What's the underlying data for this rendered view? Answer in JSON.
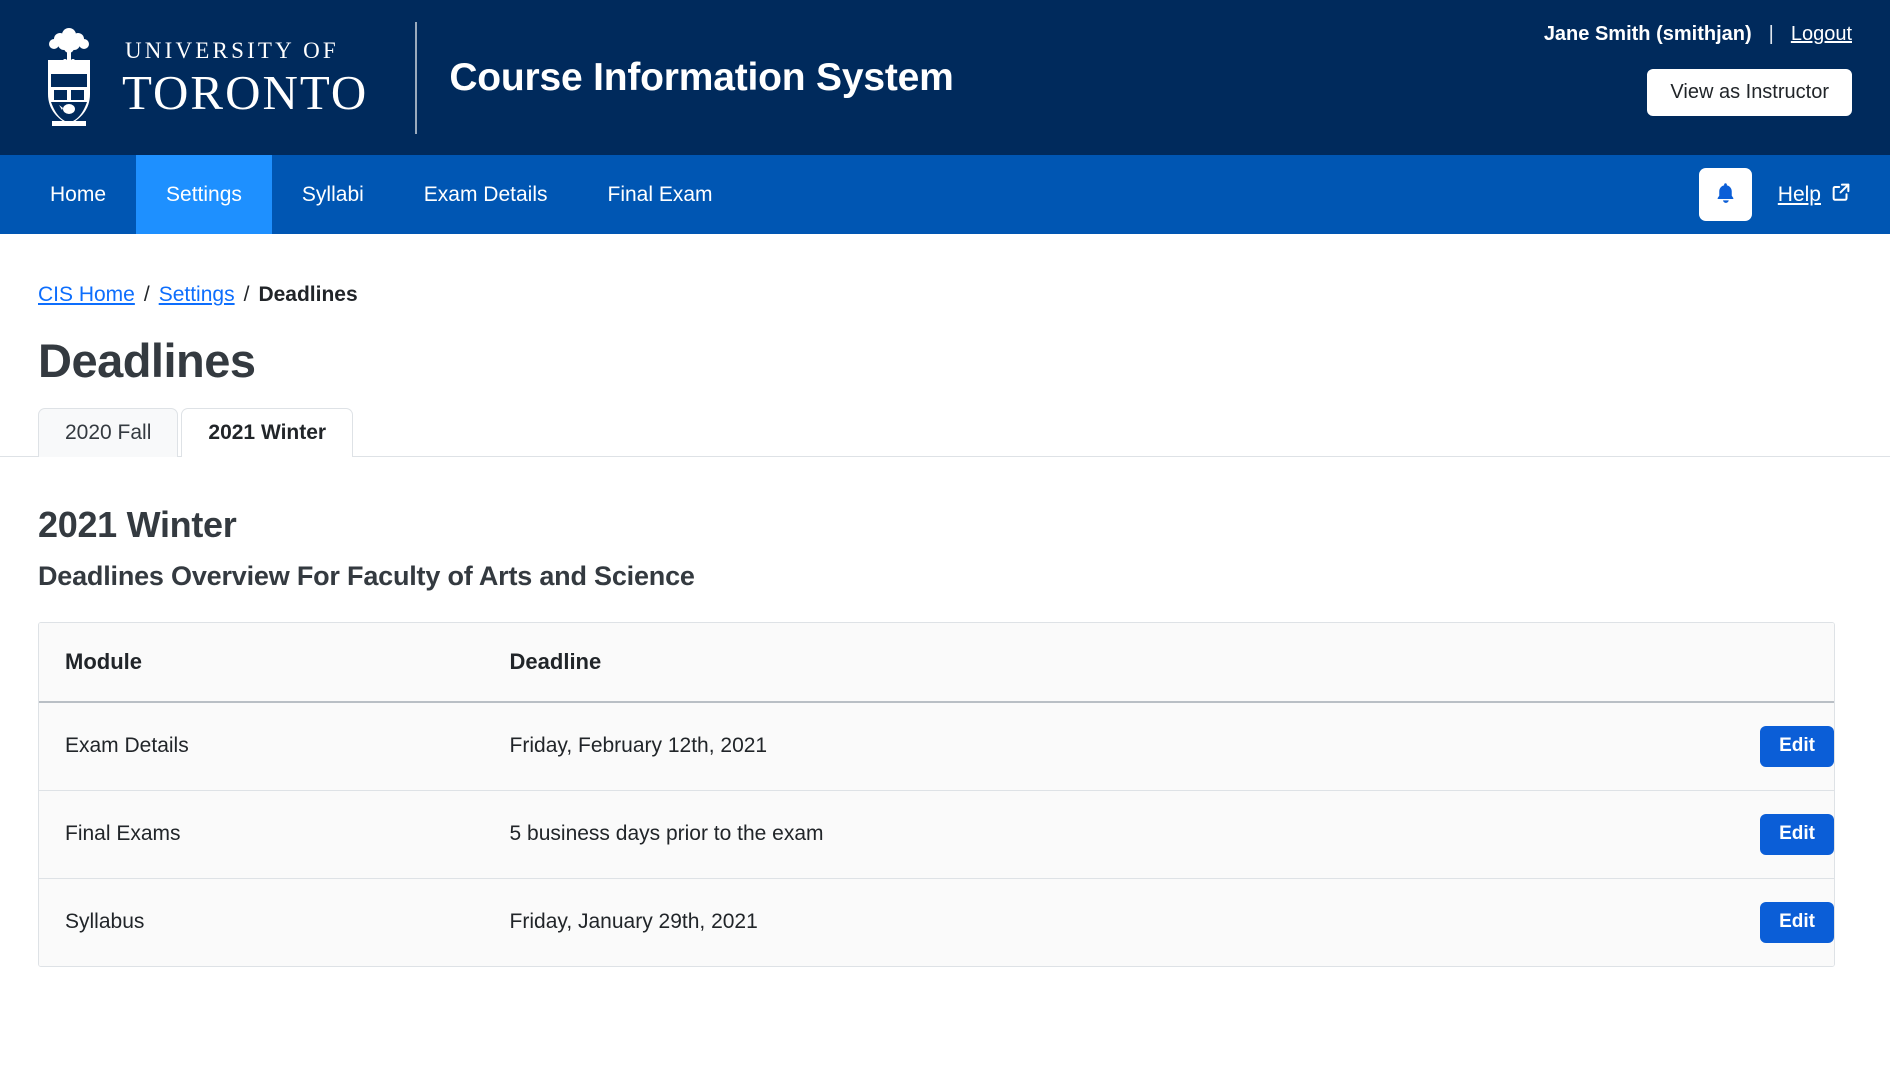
{
  "header": {
    "logo": {
      "top_line": "UNIVERSITY OF",
      "bottom_line": "TORONTO",
      "icon": "uoft-crest-icon"
    },
    "app_title": "Course Information System",
    "user_name": "Jane Smith (smithjan)",
    "separator": "|",
    "logout_label": "Logout",
    "view_as_instructor_label": "View as Instructor",
    "colors": {
      "masthead_bg": "#002A5C",
      "navbar_bg": "#0056B3",
      "navbar_active_bg": "#1E90FF"
    }
  },
  "nav": {
    "items": [
      {
        "label": "Home",
        "active": false
      },
      {
        "label": "Settings",
        "active": true
      },
      {
        "label": "Syllabi",
        "active": false
      },
      {
        "label": "Exam Details",
        "active": false
      },
      {
        "label": "Final Exam",
        "active": false
      }
    ],
    "notifications_icon": "bell-icon",
    "help_label": "Help",
    "help_external_icon": "external-link-icon"
  },
  "breadcrumb": {
    "items": [
      {
        "label": "CIS Home",
        "type": "link"
      },
      {
        "label": "Settings",
        "type": "link"
      },
      {
        "label": "Deadlines",
        "type": "current"
      }
    ],
    "separator": "/"
  },
  "page": {
    "title": "Deadlines"
  },
  "tabs": [
    {
      "label": "2020 Fall",
      "active": false
    },
    {
      "label": "2021 Winter",
      "active": true
    }
  ],
  "main": {
    "section_title": "2021 Winter",
    "section_subtitle": "Deadlines Overview For Faculty of Arts and Science",
    "table": {
      "columns": [
        "Module",
        "Deadline",
        ""
      ],
      "rows": [
        {
          "module": "Exam Details",
          "deadline": "Friday, February 12th, 2021",
          "action": "Edit"
        },
        {
          "module": "Final Exams",
          "deadline": "5 business days prior to the exam",
          "action": "Edit"
        },
        {
          "module": "Syllabus",
          "deadline": "Friday, January 29th, 2021",
          "action": "Edit"
        }
      ]
    }
  }
}
